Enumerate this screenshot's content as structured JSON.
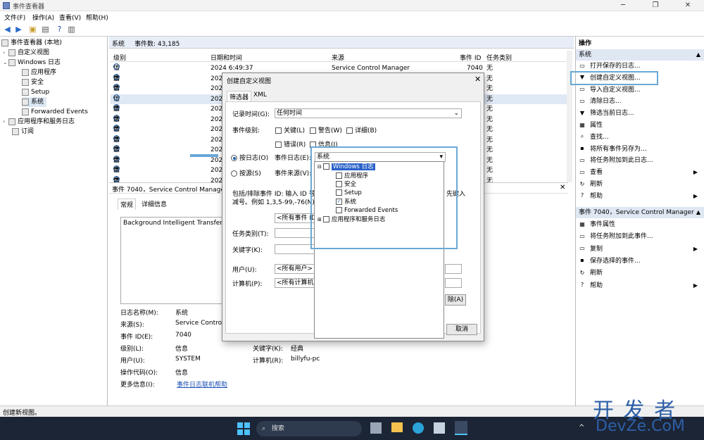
{
  "window": {
    "title": "事件查看器"
  },
  "menu": [
    "文件(F)",
    "操作(A)",
    "查看(V)",
    "帮助(H)"
  ],
  "tree": {
    "root": "事件查看器 (本地)",
    "custom_views": "自定义视图",
    "windows_logs": "Windows 日志",
    "logs": [
      "应用程序",
      "安全",
      "Setup",
      "系统",
      "Forwarded Events"
    ],
    "app_service_logs": "应用程序和服务日志",
    "subscriptions": "订阅"
  },
  "center": {
    "header_name": "系统",
    "header_count": "事件数: 43,185",
    "columns": [
      "级别",
      "日期和时间",
      "来源",
      "事件 ID",
      "任务类别"
    ],
    "first_row": {
      "level": "信息",
      "date": "2024 6:49:37",
      "source": "Service Control Manager",
      "id": "7040",
      "task": "无"
    },
    "rows": [
      {
        "level": "信息",
        "date": "202",
        "task": "无"
      },
      {
        "level": "信息",
        "date": "202",
        "task": "无"
      },
      {
        "level": "信息",
        "date": "202",
        "task": "无"
      },
      {
        "level": "信息",
        "date": "202",
        "task": "无"
      },
      {
        "level": "信息",
        "date": "202",
        "task": "无"
      },
      {
        "level": "信息",
        "date": "202",
        "task": "无"
      },
      {
        "level": "信息",
        "date": "202",
        "task": "无"
      },
      {
        "level": "信息",
        "date": "202",
        "task": "无"
      },
      {
        "level": "信息",
        "date": "202",
        "task": "无"
      },
      {
        "level": "信息",
        "date": "202",
        "task": "无"
      },
      {
        "level": "信息",
        "date": "202",
        "task": "无"
      }
    ]
  },
  "detail": {
    "title": "事件 7040，Service Control Manager",
    "tabs": [
      "常规",
      "详细信息"
    ],
    "description": "Background Intelligent Transfer Se",
    "log_name_label": "日志名称(M):",
    "log_name": "系统",
    "source_label": "来源(S):",
    "source": "Service Control",
    "event_id_label": "事件 ID(E):",
    "event_id": "7040",
    "level_label": "级别(L):",
    "level": "信息",
    "user_label": "用户(U):",
    "user": "SYSTEM",
    "opcode_label": "操作代码(O):",
    "opcode": "信息",
    "more_label": "更多信息(I):",
    "more_link": "事件日志联机帮助",
    "keywords_label": "关键字(K):",
    "keywords": "经典",
    "computer_label": "计算机(R):",
    "computer": "billyfu-pc"
  },
  "actions": {
    "header": "操作",
    "section1": "系统",
    "items1": [
      "打开保存的日志...",
      "创建自定义视图...",
      "导入自定义视图...",
      "清除日志...",
      "筛选当前日志...",
      "属性",
      "查找...",
      "将所有事件另存为...",
      "将任务附加到此日志...",
      "查看",
      "刷新",
      "帮助"
    ],
    "section2": "事件 7040，Service Control Manager",
    "items2": [
      "事件属性",
      "将任务附加到此事件...",
      "复制",
      "保存选择的事件...",
      "刷新",
      "帮助"
    ]
  },
  "dialog": {
    "title": "创建自定义视图",
    "tabs": [
      "筛选器",
      "XML"
    ],
    "logged_label": "记录时间(G):",
    "logged_value": "任何时间",
    "level_label": "事件级别:",
    "levels": [
      "关键(L)",
      "警告(W)",
      "详细(B)",
      "错误(R)",
      "信息(I)"
    ],
    "by_log": "按日志(O)",
    "by_source": "按源(S)",
    "event_logs_label": "事件日志(E):",
    "event_logs_value": "系统",
    "event_sources_label": "事件来源(V):",
    "include_text": "包括/排除事件 ID: 输入 ID 号",
    "include_text2": "减号。例如 1,3,5-99,-76(N)",
    "include_tail": "先键入",
    "all_ids": "<所有事件 ID>",
    "task_label": "任务类别(T):",
    "keywords_label": "关键字(K):",
    "user_label": "用户(U):",
    "user_value": "<所有用户>",
    "computer_label": "计算机(P):",
    "computer_value": "<所有计算机>",
    "clear_btn": "除(A)",
    "cancel_btn": "取消"
  },
  "dropdown": {
    "windows_logs": "Windows 日志",
    "logs": [
      "应用程序",
      "安全",
      "Setup",
      "系统",
      "Forwarded Events"
    ],
    "checked": "系统",
    "app_service": "应用程序和服务日志"
  },
  "status": "创建新视图。",
  "taskbar": {
    "search": "搜索"
  },
  "watermark": "开 发 者",
  "watermark2": "DevZe.CoM",
  "colors": {
    "highlight": "#6aa8d6",
    "accent": "#1a5fb4"
  }
}
